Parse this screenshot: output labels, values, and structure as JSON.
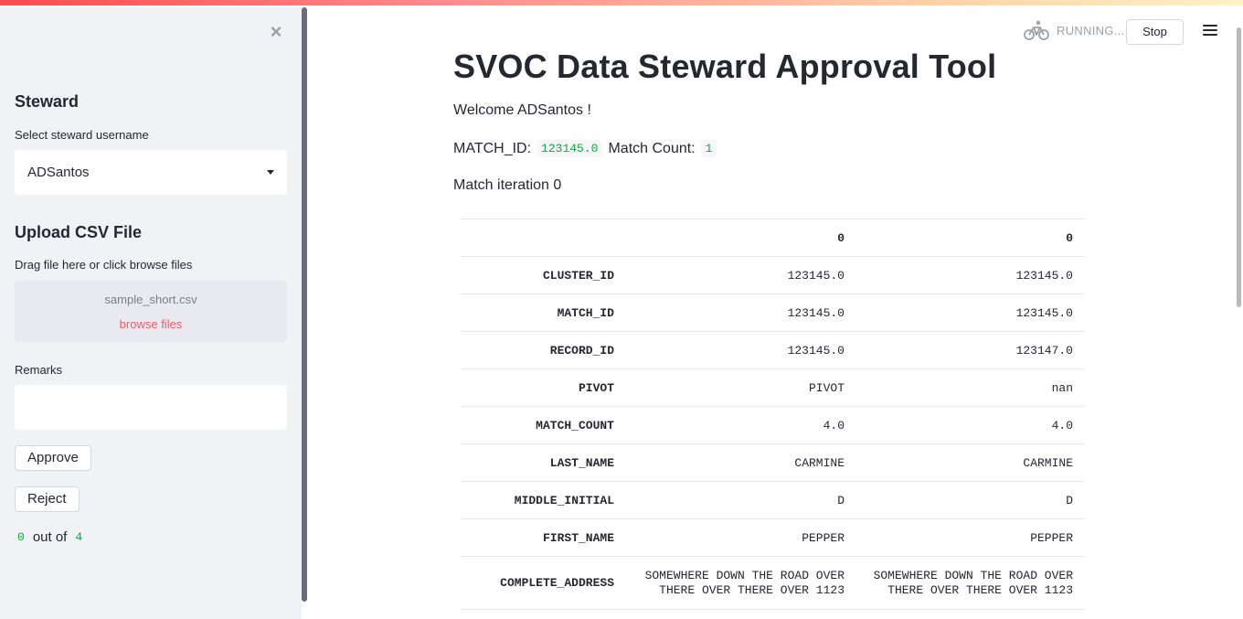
{
  "sidebar": {
    "steward_heading": "Steward",
    "select_label": "Select steward username",
    "selected_username": "ADSantos",
    "upload_heading": "Upload CSV File",
    "upload_label": "Drag file here or click browse files",
    "uploaded_file": "sample_short.csv",
    "browse_label": "browse files",
    "remarks_label": "Remarks",
    "remarks_value": "",
    "approve_label": "Approve",
    "reject_label": "Reject",
    "progress_current": "0",
    "progress_sep": "out of",
    "progress_total": "4"
  },
  "status": {
    "running_text": "RUNNING...",
    "stop_label": "Stop"
  },
  "main": {
    "title": "SVOC Data Steward Approval Tool",
    "welcome": "Welcome ADSantos !",
    "match_id_label": "MATCH_ID:",
    "match_id_value": "123145.0",
    "match_count_label": "Match Count:",
    "match_count_value": "1",
    "iteration_text": "Match iteration 0"
  },
  "table": {
    "headers": [
      "",
      "0",
      "0"
    ],
    "rows": [
      {
        "label": "CLUSTER_ID",
        "v1": "123145.0",
        "v2": "123145.0"
      },
      {
        "label": "MATCH_ID",
        "v1": "123145.0",
        "v2": "123145.0"
      },
      {
        "label": "RECORD_ID",
        "v1": "123145.0",
        "v2": "123147.0"
      },
      {
        "label": "PIVOT",
        "v1": "PIVOT",
        "v2": "nan"
      },
      {
        "label": "MATCH_COUNT",
        "v1": "4.0",
        "v2": "4.0"
      },
      {
        "label": "LAST_NAME",
        "v1": "CARMINE",
        "v2": "CARMINE"
      },
      {
        "label": "MIDDLE_INITIAL",
        "v1": "D",
        "v2": "D"
      },
      {
        "label": "FIRST_NAME",
        "v1": "PEPPER",
        "v2": "PEPPER"
      },
      {
        "label": "COMPLETE_ADDRESS",
        "v1": "SOMEWHERE DOWN THE ROAD OVER THERE OVER THERE OVER 1123",
        "v2": "SOMEWHERE DOWN THE ROAD OVER THERE OVER THERE OVER 1123"
      }
    ]
  },
  "colors": {
    "accent": "#ff4b4b",
    "code_green": "#09ab3b",
    "sidebar_bg": "#f0f2f6"
  }
}
